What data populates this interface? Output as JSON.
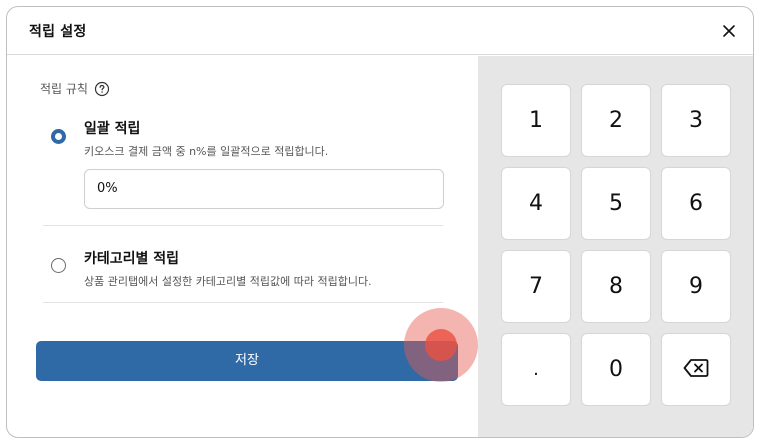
{
  "dialog": {
    "title": "적립 설정",
    "close_icon": "close-icon"
  },
  "rule": {
    "label": "적립 규칙",
    "help_icon": "question-circle-icon"
  },
  "options": [
    {
      "title": "일괄 적립",
      "description": "키오스크 결제 금액 중 n%를 일괄적으로 적립합니다.",
      "selected": true
    },
    {
      "title": "카테고리별 적립",
      "description": "상품 관리탭에서 설정한 카테고리별 적립값에 따라 적립합니다.",
      "selected": false
    }
  ],
  "rate_input": {
    "value": "0%"
  },
  "save_button": {
    "label": "저장"
  },
  "keypad": {
    "keys": [
      "1",
      "2",
      "3",
      "4",
      "5",
      "6",
      "7",
      "8",
      "9",
      ".",
      "0"
    ],
    "backspace_icon": "backspace-icon"
  },
  "colors": {
    "accent": "#2f6aa6",
    "keypad_bg": "#e6e6e6",
    "touch_indicator": "#e75a50"
  }
}
